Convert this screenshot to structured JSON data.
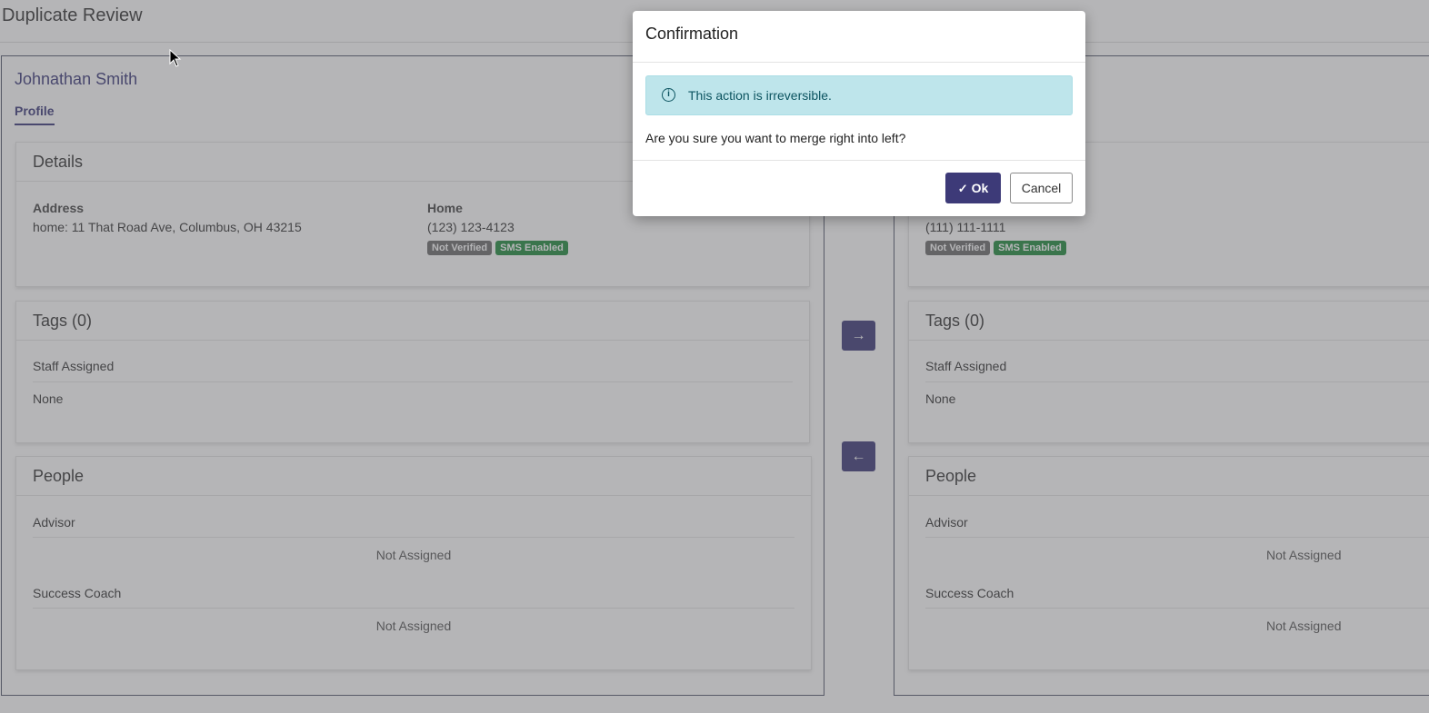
{
  "page": {
    "title": "Duplicate Review"
  },
  "left": {
    "name": "Johnathan Smith",
    "tab": "Profile",
    "details": {
      "header": "Details",
      "address_label": "Address",
      "address_value": "home: 11 That Road Ave, Columbus, OH 43215",
      "phone_label": "Home",
      "phone_value": "(123) 123-4123",
      "badge_verified": "Not Verified",
      "badge_sms": "SMS Enabled"
    },
    "tags": {
      "header": "Tags (0)",
      "staff_label": "Staff Assigned",
      "staff_value": "None"
    },
    "people": {
      "header": "People",
      "advisor_label": "Advisor",
      "advisor_value": "Not Assigned",
      "coach_label": "Success Coach",
      "coach_value": "Not Assigned"
    }
  },
  "right": {
    "details": {
      "phone_value": "(111) 111-1111",
      "badge_verified": "Not Verified",
      "badge_sms": "SMS Enabled"
    },
    "tags": {
      "header": "Tags (0)",
      "staff_label": "Staff Assigned",
      "staff_value": "None"
    },
    "people": {
      "header": "People",
      "advisor_label": "Advisor",
      "advisor_value": "Not Assigned",
      "coach_label": "Success Coach",
      "coach_value": "Not Assigned"
    }
  },
  "controls": {
    "merge_right_icon": "arrow-right-icon",
    "merge_left_icon": "arrow-left-icon"
  },
  "modal": {
    "title": "Confirmation",
    "alert_text": "This action is irreversible.",
    "question": "Are you sure you want to merge right into left?",
    "ok_label": "Ok",
    "cancel_label": "Cancel"
  },
  "colors": {
    "primary": "#3d3a78",
    "alert_bg": "#bee5eb",
    "badge_gray": "#6c6c6c",
    "badge_green": "#1f8a3c"
  }
}
